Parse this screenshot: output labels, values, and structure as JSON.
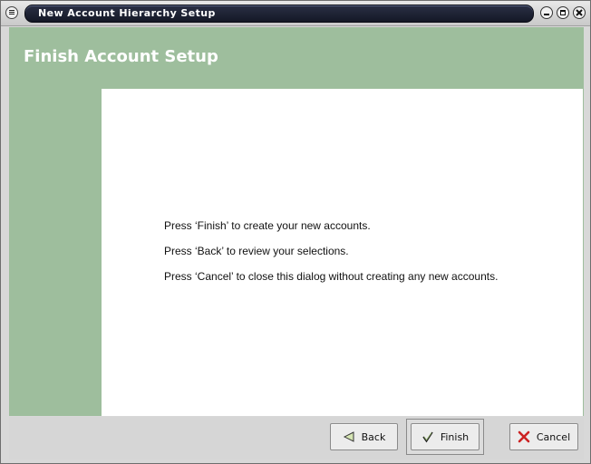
{
  "window": {
    "title": "New Account Hierarchy Setup"
  },
  "page": {
    "heading": "Finish Account Setup",
    "messages": [
      "Press ‘Finish’ to create your new accounts.",
      "Press ‘Back’ to review your selections.",
      "Press ‘Cancel’ to close this dialog without creating any new accounts."
    ]
  },
  "buttons": {
    "back": "Back",
    "finish": "Finish",
    "cancel": "Cancel"
  },
  "icons": {
    "back": "back-arrow-icon",
    "finish": "checkmark-icon",
    "cancel": "red-x-icon"
  },
  "colors": {
    "accent_green": "#9ebe9d",
    "title_bar_pill": "#1c2132",
    "cancel_icon_red": "#cc2222"
  }
}
